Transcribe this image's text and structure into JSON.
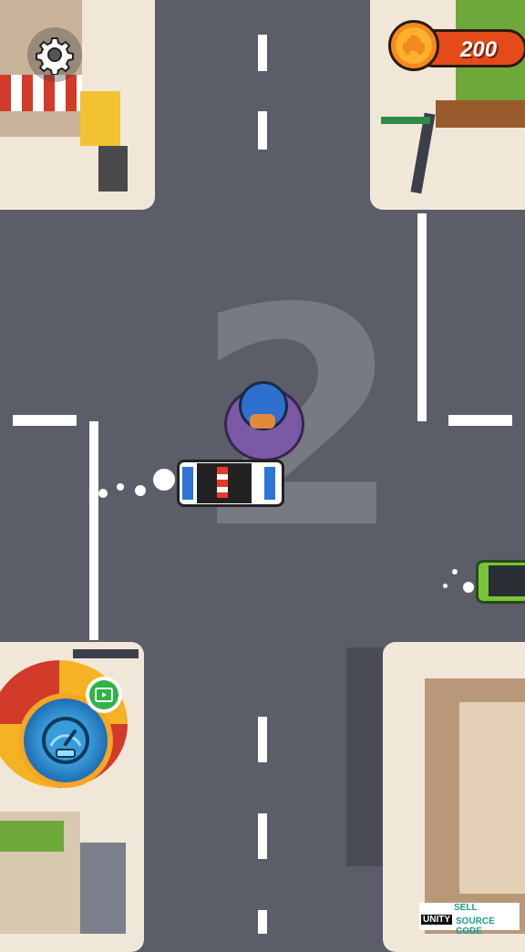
{
  "hud": {
    "coins": "200",
    "coin_icon": "taxi-coin-icon",
    "settings_icon": "gear-icon",
    "boost_icon": "speedometer-icon",
    "video_icon": "video-ad-icon"
  },
  "road": {
    "stage_number": "2"
  },
  "watermark": {
    "line1": "SELL",
    "line2a": "UNITY",
    "line2b": "SOURCE CODE"
  },
  "colors": {
    "road": "#5b5d68",
    "sidewalk": "#f1e7d9",
    "coin_pill": "#e54b1a",
    "coin_icon": "#f28a1d",
    "boost_ring": "#f5a623",
    "video_badge": "#2fb344",
    "player_circle": "#7a5aa6",
    "player_car_green": "#79c33b"
  }
}
